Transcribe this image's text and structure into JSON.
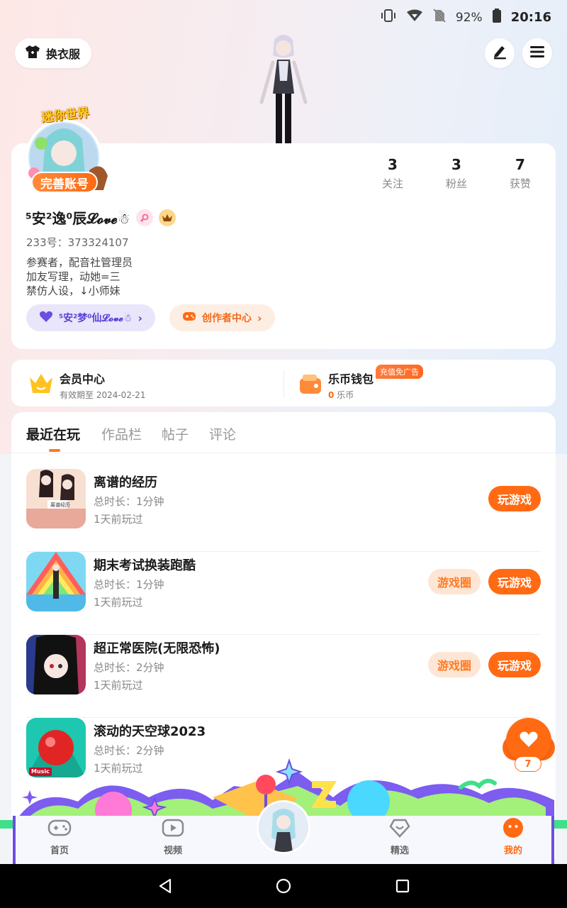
{
  "status_bar": {
    "battery": "92%",
    "time": "20:16"
  },
  "header": {
    "outfit_label": "换衣服"
  },
  "profile": {
    "complete_label": "完善账号",
    "avatar_badge_text": "迷你世界",
    "username": "⁵安²逸⁰辰𝓛𝓸𝓿𝓮☃",
    "uid": "233号：373324107",
    "bio": [
      "参赛者，配音社管理员",
      "加友写理，动她=三",
      "禁仿人设，↓小师妹"
    ],
    "stats": [
      {
        "value": "3",
        "label": "关注"
      },
      {
        "value": "3",
        "label": "粉丝"
      },
      {
        "value": "7",
        "label": "获赞"
      }
    ],
    "chip_partner": "⁵安²梦⁰仙𝓛𝓸𝓿𝓮☃",
    "chip_creator": "创作者中心"
  },
  "member": {
    "vip_title": "会员中心",
    "vip_sub": "有效期至 2024-02-21",
    "wallet_title": "乐币钱包",
    "wallet_tag": "充值免广告",
    "wallet_amount": "0",
    "wallet_unit": "乐币"
  },
  "tabs": [
    "最近在玩",
    "作品栏",
    "帖子",
    "评论"
  ],
  "games": [
    {
      "title": "离谱的经历",
      "duration": "总时长：1分钟",
      "last_played": "1天前玩过",
      "has_circle": false,
      "thumb_text": "离谱经历"
    },
    {
      "title": "期末考试换装跑酷",
      "duration": "总时长：1分钟",
      "last_played": "1天前玩过",
      "has_circle": true
    },
    {
      "title": "超正常医院(无限恐怖)",
      "duration": "总时长：2分钟",
      "last_played": "1天前玩过",
      "has_circle": true
    },
    {
      "title": "滚动的天空球2023",
      "duration": "总时长：2分钟",
      "last_played": "1天前玩过",
      "has_circle": false,
      "thumb_text": "Music"
    }
  ],
  "buttons": {
    "play": "玩游戏",
    "play_partial": "玩",
    "circle": "游戏圈"
  },
  "like": {
    "count": "7"
  },
  "nav": [
    {
      "label": "首页",
      "icon": "gamepad-icon"
    },
    {
      "label": "视频",
      "icon": "video-play-icon"
    },
    {
      "label": "精选",
      "icon": "heart-diamond-icon"
    },
    {
      "label": "我的",
      "icon": "face-icon"
    }
  ],
  "colors": {
    "accent": "#ff6a13",
    "purple": "#6c4fe0",
    "chip_purple_bg": "#e9e6fb",
    "chip_orange_bg": "#fdeee3"
  }
}
